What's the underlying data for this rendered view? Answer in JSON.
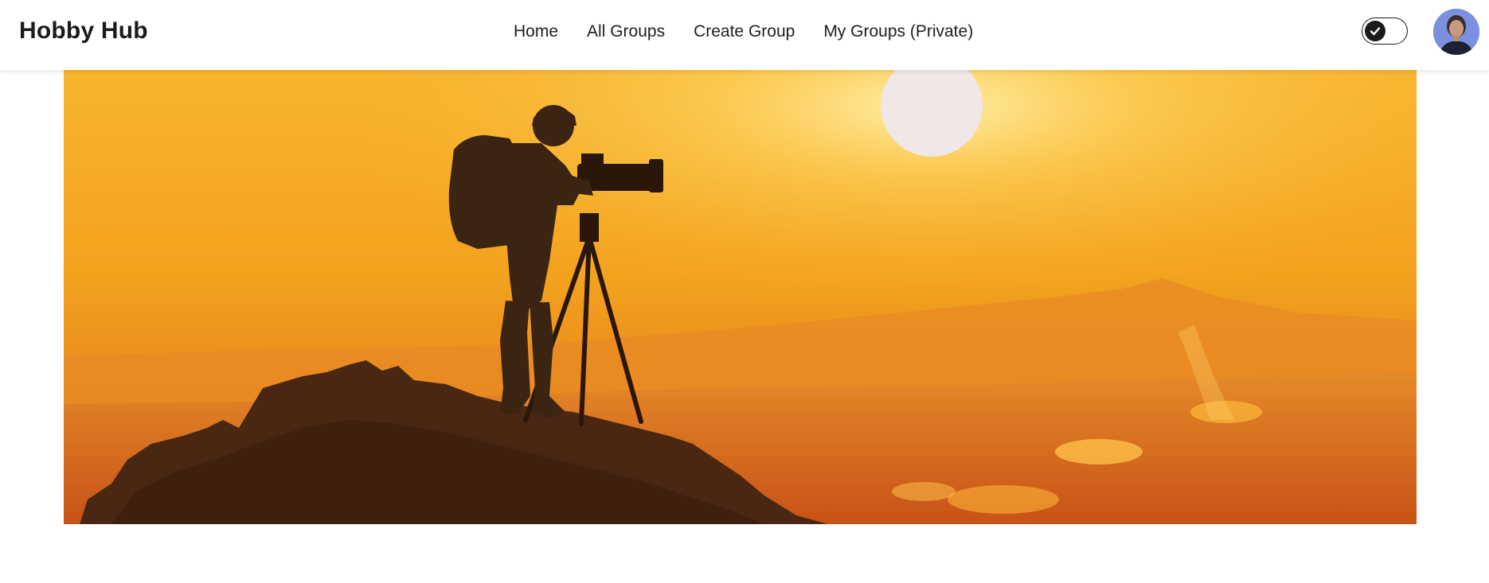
{
  "brand": {
    "name": "Hobby Hub"
  },
  "nav": {
    "links": [
      {
        "label": "Home"
      },
      {
        "label": "All Groups"
      },
      {
        "label": "Create Group"
      },
      {
        "label": "My Groups (Private)"
      }
    ]
  },
  "theme_toggle": {
    "state": "on",
    "icon": "check-icon"
  },
  "profile": {
    "avatar": "user-avatar"
  },
  "hero": {
    "image": "photographer-with-tripod-at-sunset"
  },
  "colors": {
    "navbar_bg": "#ffffff",
    "text": "#1b1b1b",
    "sky_top": "#f6b22a",
    "sky_bottom": "#e07a18"
  }
}
